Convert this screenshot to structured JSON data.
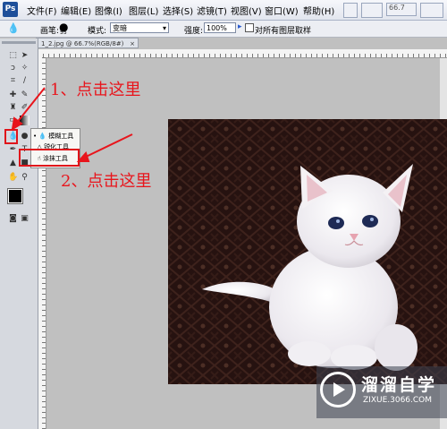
{
  "menubar": {
    "logo": "Ps",
    "items": [
      "文件(F)",
      "编辑(E)",
      "图像(I)",
      "图层(L)",
      "选择(S)",
      "滤镜(T)",
      "视图(V)",
      "窗口(W)",
      "帮助(H)"
    ],
    "zoom": "66.7"
  },
  "options": {
    "brush_label": "画笔:",
    "brush_size": "55",
    "mode_label": "模式:",
    "mode_value": "变暗",
    "strength_label": "强度:",
    "strength_value": "100%",
    "sample_all_label": "对所有图层取样"
  },
  "document": {
    "tab_title": "1_2.jpg @ 66.7%(RGB/8#)"
  },
  "flyout": {
    "items": [
      "模糊工具",
      "锐化工具",
      "涂抹工具"
    ]
  },
  "annotations": {
    "step1": "1、点击这里",
    "step2": "2、点击这里"
  },
  "watermark": {
    "title": "溜溜自学",
    "url": "ZIXUE.3066.COM"
  },
  "colors": {
    "annotation": "#e8151c",
    "toolbar_blue": "#1e4f9a"
  }
}
